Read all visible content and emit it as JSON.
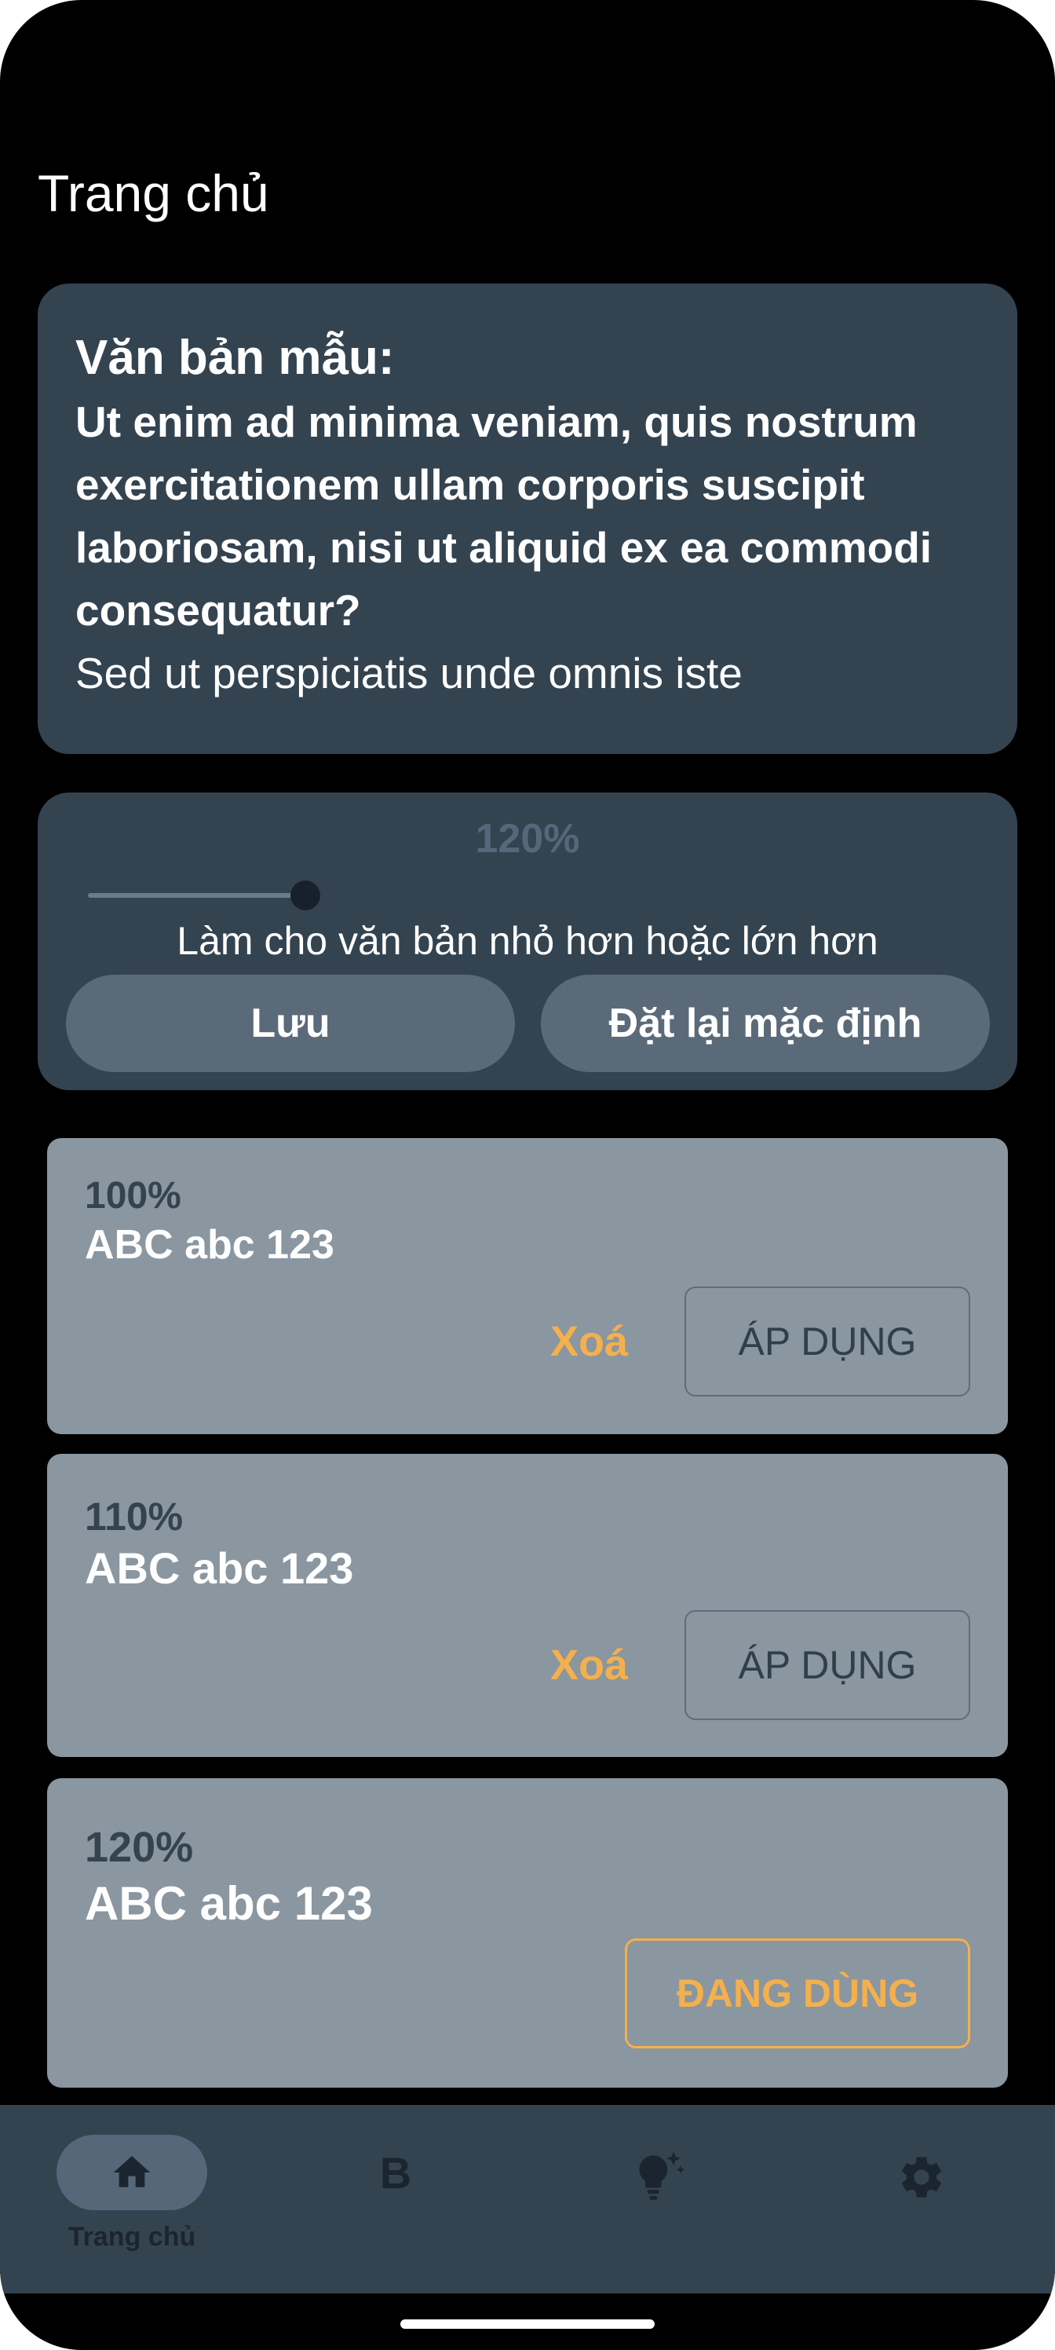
{
  "page": {
    "title": "Trang chủ"
  },
  "sample": {
    "heading": "Văn bản mẫu:",
    "bold_text": "Ut enim ad minima veniam, quis nostrum exercitationem ullam corporis suscipit laboriosam, nisi ut aliquid ex ea commodi consequatur?",
    "regular_text": "Sed ut perspiciatis unde omnis iste"
  },
  "size_control": {
    "value_label": "120%",
    "slider_level": 0.2,
    "hint": "Làm cho văn bản nhỏ hơn hoặc lớn hơn",
    "save_label": "Lưu",
    "reset_label": "Đặt lại mặc định"
  },
  "presets": [
    {
      "percent": "100%",
      "sample": "ABC abc 123",
      "delete_label": "Xoá",
      "apply_label": "ÁP DỤNG"
    },
    {
      "percent": "110%",
      "sample": "ABC abc 123",
      "delete_label": "Xoá",
      "apply_label": "ÁP DỤNG"
    },
    {
      "percent": "120%",
      "sample": "ABC abc 123",
      "active_label": "ĐANG DÙNG"
    }
  ],
  "bottom_nav": {
    "items": [
      {
        "icon": "home-icon",
        "label": "Trang chủ",
        "selected": true
      },
      {
        "icon": "bold-icon",
        "letter": "B"
      },
      {
        "icon": "lightbulb-sparkle-icon"
      },
      {
        "icon": "gear-icon"
      }
    ]
  },
  "colors": {
    "background": "#000000",
    "card": "#344350",
    "preset_card": "#8a96a0",
    "accent": "#f4b04d",
    "button": "#5b6a79"
  }
}
